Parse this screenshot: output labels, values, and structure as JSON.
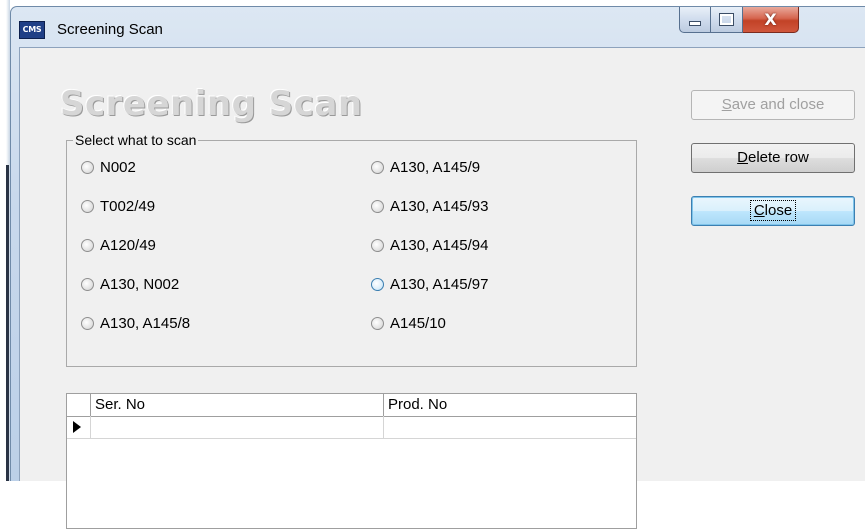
{
  "window": {
    "title": "Screening Scan",
    "icon_text": "CMS",
    "controls": {
      "close_glyph": "X"
    }
  },
  "form": {
    "heading": "Screening Scan"
  },
  "scan_group": {
    "legend": "Select what to scan",
    "options": [
      {
        "label": "N002",
        "selected": false
      },
      {
        "label": "T002/49",
        "selected": false
      },
      {
        "label": "A120/49",
        "selected": false
      },
      {
        "label": "A130, N002",
        "selected": false
      },
      {
        "label": "A130, A145/8",
        "selected": false
      },
      {
        "label": "A130, A145/9",
        "selected": false
      },
      {
        "label": "A130, A145/93",
        "selected": false
      },
      {
        "label": "A130, A145/94",
        "selected": false
      },
      {
        "label": "A130, A145/97",
        "selected": false
      },
      {
        "label": "A145/10",
        "selected": false
      }
    ]
  },
  "buttons": {
    "save_and_close": {
      "mnemonic": "S",
      "rest": "ave and close",
      "enabled": false
    },
    "delete_row": {
      "mnemonic": "D",
      "rest": "elete row",
      "enabled": true
    },
    "close": {
      "mnemonic": "C",
      "rest": "lose",
      "enabled": true
    }
  },
  "grid": {
    "columns": [
      "Ser. No",
      "Prod. No"
    ],
    "rows": [
      {
        "ser_no": "",
        "prod_no": ""
      }
    ]
  },
  "colors": {
    "titlebar": "#c9d9ec",
    "client": "#f0f0f0",
    "heading_text": "#d6d6d6",
    "focus_blue": "#3c7fb1",
    "close_red": "#c24227"
  }
}
